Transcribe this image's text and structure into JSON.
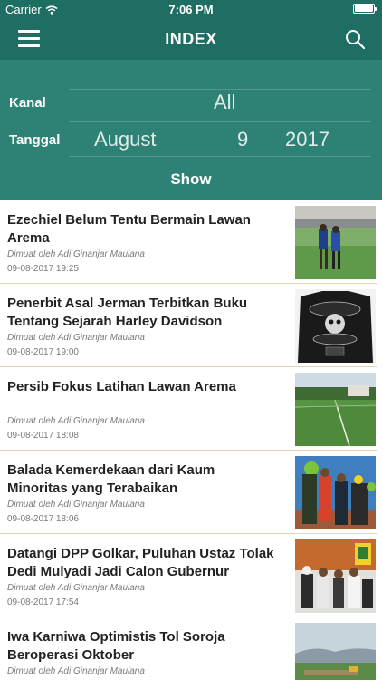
{
  "status_bar": {
    "carrier": "Carrier",
    "time": "7:06 PM",
    "wifi_icon": "wifi-icon",
    "battery_icon": "battery-icon"
  },
  "nav": {
    "title": "INDEX",
    "menu_icon": "hamburger-menu-icon",
    "search_icon": "search-icon"
  },
  "colors": {
    "header": "#1f6e63",
    "panel": "#2e8275",
    "divider": "#e6d2b4",
    "title_text": "#222222",
    "meta_text": "#7a7a7a"
  },
  "filter": {
    "kanal_label": "Kanal",
    "kanal_value": "All",
    "tanggal_label": "Tanggal",
    "month": "August",
    "day": "9",
    "year": "2017",
    "show_label": "Show"
  },
  "news": [
    {
      "title": "Ezechiel Belum Tentu Bermain Lawan Arema",
      "author": "Dimuat oleh Adi Ginanjar Maulana",
      "date": "09-08-2017 19:25",
      "image": "football-players-photo"
    },
    {
      "title": "Penerbit Asal Jerman Terbitkan Buku Tentang Sejarah Harley Davidson",
      "author": "Dimuat oleh Adi Ginanjar Maulana",
      "date": "09-08-2017 19:00",
      "image": "harley-davidson-jacket-photo"
    },
    {
      "title": "Persib Fokus Latihan Lawan Arema",
      "author": "Dimuat oleh Adi Ginanjar Maulana",
      "date": "09-08-2017 18:08",
      "image": "football-field-photo"
    },
    {
      "title": "Balada Kemerdekaan dari Kaum Minoritas yang Terabaikan",
      "author": "Dimuat oleh Adi Ginanjar Maulana",
      "date": "09-08-2017 18:06",
      "image": "crowd-event-photo"
    },
    {
      "title": "Datangi DPP Golkar, Puluhan Ustaz Tolak Dedi Mulyadi Jadi Calon Gubernur",
      "author": "Dimuat oleh Adi Ginanjar Maulana",
      "date": "09-08-2017 17:54",
      "image": "meeting-photo"
    },
    {
      "title": "Iwa Karniwa Optimistis Tol Soroja Beroperasi Oktober",
      "author": "Dimuat oleh Adi Ginanjar Maulana",
      "date": "",
      "image": "construction-site-photo"
    }
  ]
}
